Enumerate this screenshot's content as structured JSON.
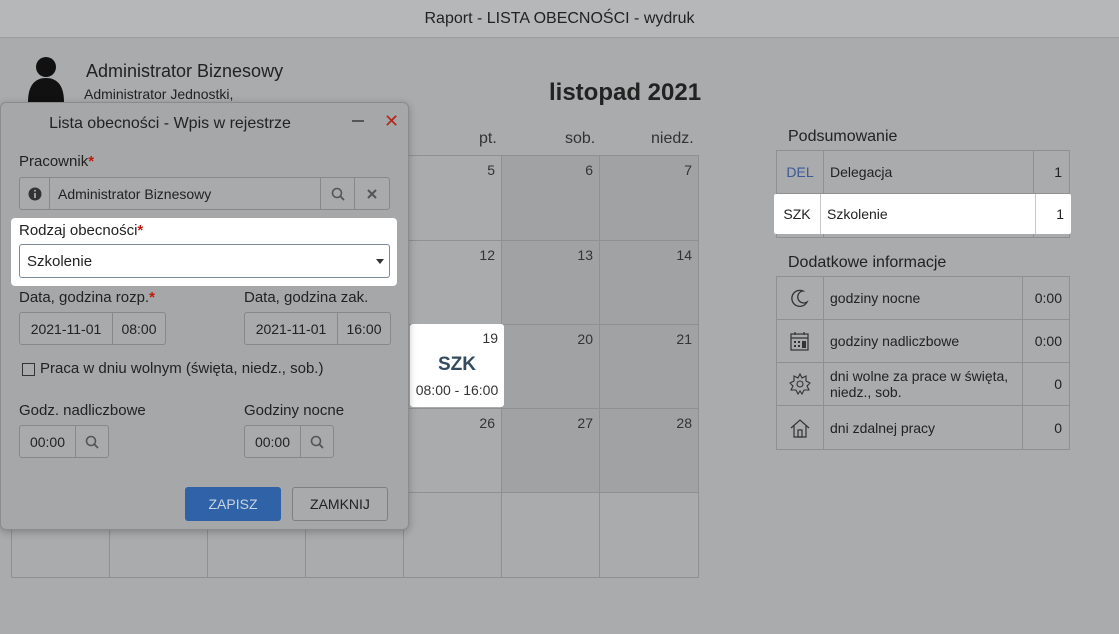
{
  "window": {
    "title": "Raport - LISTA OBECNOŚCI - wydruk"
  },
  "user": {
    "name": "Administrator Biznesowy",
    "role": "Administrator Jednostki,"
  },
  "calendar": {
    "month_title": "listopad 2021",
    "visible_day_headers": [
      "pt.",
      "sob.",
      "niedz."
    ],
    "day_numbers": [
      "5",
      "6",
      "7",
      "12",
      "13",
      "14",
      "19",
      "20",
      "21",
      "26",
      "27",
      "28"
    ],
    "highlight": {
      "day": "19",
      "code": "SZK",
      "time": "08:00 - 16:00"
    }
  },
  "summary": {
    "title": "Podsumowanie",
    "rows": [
      {
        "code": "DEL",
        "label": "Delegacja",
        "value": "1",
        "code_color": "#3c5a96"
      },
      {
        "code": "SZK",
        "label": "Szkolenie",
        "value": "1"
      }
    ]
  },
  "extra_info": {
    "title": "Dodatkowe informacje",
    "rows": [
      {
        "icon": "moon-icon",
        "label": "godziny nocne",
        "value": "0:00"
      },
      {
        "icon": "calendar-clock-icon",
        "label": "godziny nadliczbowe",
        "value": "0:00"
      },
      {
        "icon": "gear-badge-icon",
        "label": "dni wolne za prace w święta, niedz., sob.",
        "value": "0"
      },
      {
        "icon": "home-icon",
        "label": "dni zdalnej pracy",
        "value": "0"
      }
    ]
  },
  "modal": {
    "title": "Lista obecności - Wpis w rejestrze",
    "employee_label": "Pracownik",
    "employee_value": "Administrator Biznesowy",
    "attendance_type_label": "Rodzaj obecności",
    "attendance_type_value": "Szkolenie",
    "start_label": "Data, godzina rozp.",
    "start_date": "2021-11-01",
    "start_time": "08:00",
    "end_label": "Data, godzina zak.",
    "end_date": "2021-11-01",
    "end_time": "16:00",
    "holiday_work_label": "Praca w dniu wolnym (święta, niedz., sob.)",
    "overtime_label": "Godz. nadliczbowe",
    "overtime_value": "00:00",
    "night_label": "Godziny nocne",
    "night_value": "00:00",
    "save_label": "ZAPISZ",
    "close_label": "ZAMKNIJ",
    "required_mark": "*"
  },
  "colors": {
    "primary": "#2f62a6",
    "required": "#c0180c",
    "close_x": "#b3261e"
  }
}
